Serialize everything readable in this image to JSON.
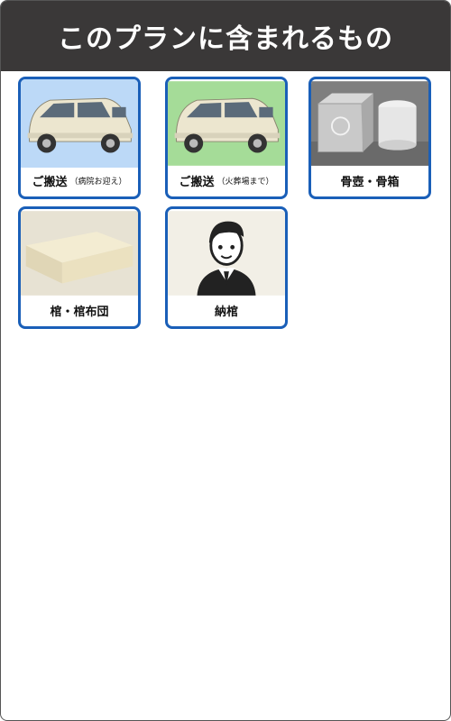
{
  "header": {
    "title": "このプランに含まれるもの"
  },
  "items": [
    {
      "main": "ご搬送",
      "note": "（病院お迎え）"
    },
    {
      "main": "ご搬送",
      "note": "（火葬場まで）"
    },
    {
      "main": "骨壺・骨箱",
      "note": ""
    },
    {
      "main": "棺・棺布団",
      "note": ""
    },
    {
      "main": "納棺",
      "note": ""
    }
  ]
}
